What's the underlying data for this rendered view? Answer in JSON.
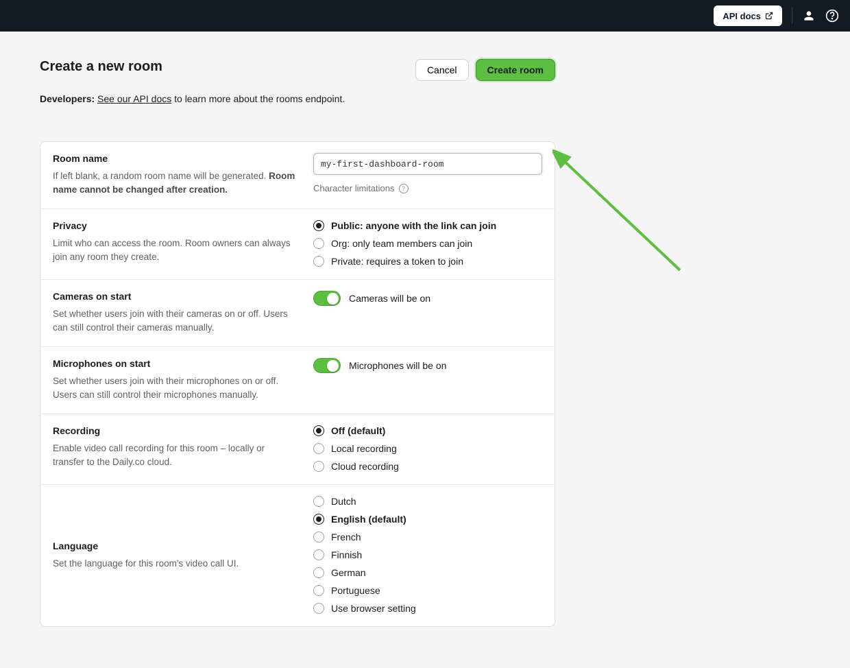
{
  "topbar": {
    "api_docs": "API docs"
  },
  "page": {
    "title": "Create a new room",
    "cancel": "Cancel",
    "create": "Create room",
    "dev_prefix": "Developers:",
    "dev_link": "See our API docs",
    "dev_suffix": " to learn more about the rooms endpoint."
  },
  "room_name": {
    "label": "Room name",
    "desc_pre": "If left blank, a random room name will be generated. ",
    "desc_strong": "Room name cannot be changed after creation.",
    "value": "my-first-dashboard-room",
    "char_lim": "Character limitations"
  },
  "privacy": {
    "label": "Privacy",
    "desc": "Limit who can access the room. Room owners can always join any room they create.",
    "options": [
      {
        "label": "Public: anyone with the link can join",
        "selected": true
      },
      {
        "label": "Org: only team members can join",
        "selected": false
      },
      {
        "label": "Private: requires a token to join",
        "selected": false
      }
    ]
  },
  "cameras": {
    "label": "Cameras on start",
    "desc": "Set whether users join with their cameras on or off. Users can still control their cameras manually.",
    "state_label": "Cameras will be on",
    "on": true
  },
  "mics": {
    "label": "Microphones on start",
    "desc": "Set whether users join with their microphones on or off. Users can still control their microphones manually.",
    "state_label": "Microphones will be on",
    "on": true
  },
  "recording": {
    "label": "Recording",
    "desc": "Enable video call recording for this room – locally or transfer to the Daily.co cloud.",
    "options": [
      {
        "label": "Off (default)",
        "selected": true
      },
      {
        "label": "Local recording",
        "selected": false
      },
      {
        "label": "Cloud recording",
        "selected": false
      }
    ]
  },
  "language": {
    "label": "Language",
    "desc": "Set the language for this room's video call UI.",
    "options": [
      {
        "label": "Dutch",
        "selected": false
      },
      {
        "label": "English (default)",
        "selected": true
      },
      {
        "label": "French",
        "selected": false
      },
      {
        "label": "Finnish",
        "selected": false
      },
      {
        "label": "German",
        "selected": false
      },
      {
        "label": "Portuguese",
        "selected": false
      },
      {
        "label": "Use browser setting",
        "selected": false
      }
    ]
  }
}
